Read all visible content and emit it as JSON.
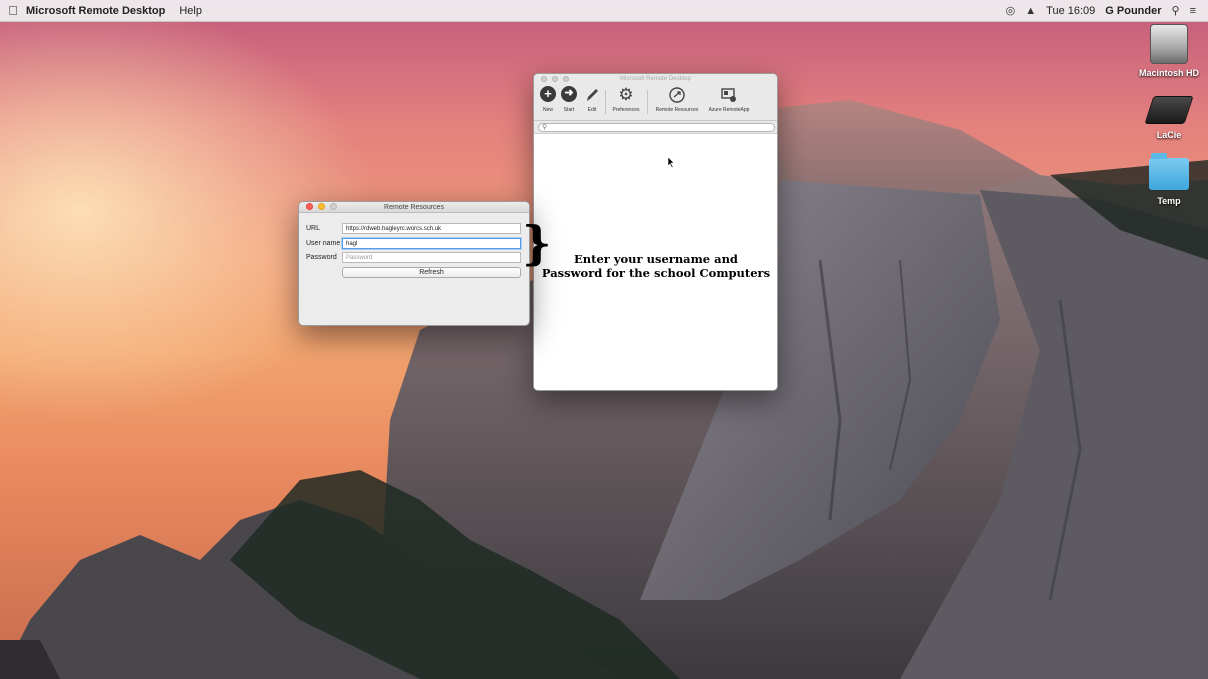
{
  "menubar": {
    "app_name": "Microsoft Remote Desktop",
    "items": [
      "Help"
    ],
    "clock": "Tue 16:09",
    "user": "G Pounder",
    "icons": [
      "apple-icon",
      "wifi-icon",
      "spotlight-icon",
      "notification-center-icon"
    ]
  },
  "desktop": {
    "icons": [
      {
        "label": "Macintosh HD",
        "icon": "hard-drive-icon"
      },
      {
        "label": "LaCie",
        "icon": "external-drive-icon"
      },
      {
        "label": "Temp",
        "icon": "folder-icon"
      }
    ]
  },
  "mrd_window": {
    "title": "Microsoft Remote Desktop",
    "toolbar": [
      {
        "label": "New",
        "icon": "plus-circle-icon"
      },
      {
        "label": "Start",
        "icon": "arrow-circle-icon"
      },
      {
        "label": "Edit",
        "icon": "pencil-icon"
      },
      {
        "label": "Preferences",
        "icon": "gear-icon"
      },
      {
        "label": "Remote Resources",
        "icon": "remote-resources-icon"
      },
      {
        "label": "Azure RemoteApp",
        "icon": "azure-remoteapp-icon"
      }
    ],
    "search_placeholder": ""
  },
  "rr_window": {
    "title": "Remote Resources",
    "url_label": "URL",
    "url_value": "https://rdweb.hagleyrc.worcs.sch.uk",
    "username_label": "User name",
    "username_value": "hagl",
    "password_label": "Password",
    "password_placeholder": "Password",
    "refresh_label": "Refresh"
  },
  "annotation": {
    "line1": "Enter your username and",
    "line2": "Password for the school Computers"
  },
  "colors": {
    "close": "#ff5f57",
    "minimize": "#febc2e",
    "zoom": "#28c840",
    "focus_ring": "#5a9be8"
  }
}
